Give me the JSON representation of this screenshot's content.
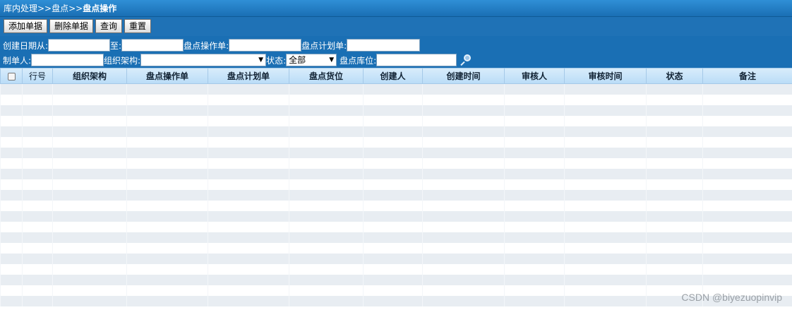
{
  "breadcrumb": {
    "path": "库内处理>>盘点>>",
    "current": "盘点操作"
  },
  "toolbar": {
    "add_label": "添加单据",
    "delete_label": "删除单据",
    "query_label": "查询",
    "reset_label": "重置"
  },
  "filters": {
    "created_from_label": "创建日期从:",
    "created_to_label": "至:",
    "operation_no_label": "盘点操作单:",
    "plan_no_label": "盘点计划单:",
    "creator_label": "制单人:",
    "org_label": "组织架构:",
    "status_label": "状态:",
    "status_value": "全部",
    "location_label": "盘点库位:",
    "created_from_value": "",
    "created_to_value": "",
    "operation_no_value": "",
    "plan_no_value": "",
    "creator_value": "",
    "org_value": "",
    "location_value": ""
  },
  "icons": {
    "search": "search-icon",
    "dropdown": "chevron-down-icon"
  },
  "table": {
    "columns": [
      "行号",
      "组织架构",
      "盘点操作单",
      "盘点计划单",
      "盘点货位",
      "创建人",
      "创建时间",
      "审核人",
      "审核时间",
      "状态",
      "备注"
    ],
    "rows": []
  },
  "watermark": "CSDN @biyezuopinvip",
  "colors": {
    "header_blue": "#1a6fb4",
    "grid_header": "#b9dcf7",
    "stripe": "#e8edf2"
  }
}
